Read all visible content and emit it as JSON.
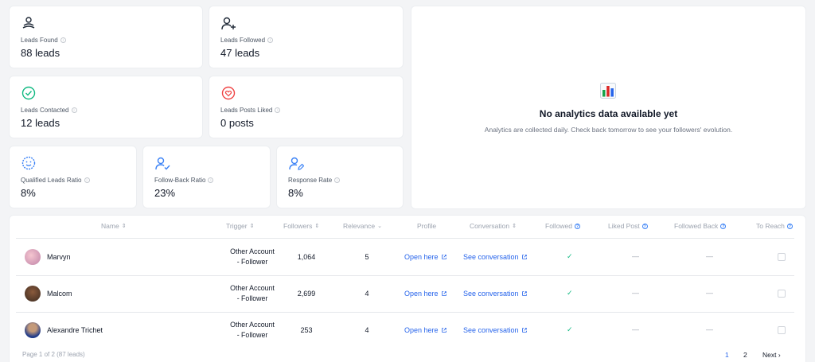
{
  "stats": [
    {
      "label": "Leads Found",
      "value": "88 leads",
      "icon": "leads-found-icon"
    },
    {
      "label": "Leads Followed",
      "value": "47 leads",
      "icon": "user-plus-icon"
    },
    {
      "label": "Leads Contacted",
      "value": "12 leads",
      "icon": "check-circle-icon"
    },
    {
      "label": "Leads Posts Liked",
      "value": "0 posts",
      "icon": "heart-icon"
    },
    {
      "label": "Qualified Leads Ratio",
      "value": "8%",
      "icon": "smile-icon"
    },
    {
      "label": "Follow-Back Ratio",
      "value": "23%",
      "icon": "user-check-icon"
    },
    {
      "label": "Response Rate",
      "value": "8%",
      "icon": "user-edit-icon"
    }
  ],
  "analytics": {
    "title": "No analytics data available yet",
    "subtitle": "Analytics are collected daily. Check back tomorrow to see your followers' evolution."
  },
  "table": {
    "headers": {
      "name": "Name",
      "trigger": "Trigger",
      "followers": "Followers",
      "relevance": "Relevance",
      "profile": "Profile",
      "conversation": "Conversation",
      "followed": "Followed",
      "liked_post": "Liked Post",
      "followed_back": "Followed Back",
      "to_reach": "To Reach"
    },
    "rows": [
      {
        "name": "Marvyn",
        "trigger_line1": "Other Account",
        "trigger_line2": "- Follower",
        "followers": "1,064",
        "relevance": "5",
        "profile": "Open here",
        "conversation": "See conversation",
        "followed": "✓",
        "liked": "—",
        "followed_back": "—"
      },
      {
        "name": "Malcom",
        "trigger_line1": "Other Account",
        "trigger_line2": "- Follower",
        "followers": "2,699",
        "relevance": "4",
        "profile": "Open here",
        "conversation": "See conversation",
        "followed": "✓",
        "liked": "—",
        "followed_back": "—"
      },
      {
        "name": "Alexandre Trichet",
        "trigger_line1": "Other Account",
        "trigger_line2": "- Follower",
        "followers": "253",
        "relevance": "4",
        "profile": "Open here",
        "conversation": "See conversation",
        "followed": "✓",
        "liked": "—",
        "followed_back": "—"
      }
    ]
  },
  "pagination": {
    "info": "Page 1 of 2 (87 leads)",
    "pages": [
      "1",
      "2"
    ],
    "next": "Next"
  },
  "colors": {
    "accent": "#2563eb",
    "success": "#10b981"
  }
}
